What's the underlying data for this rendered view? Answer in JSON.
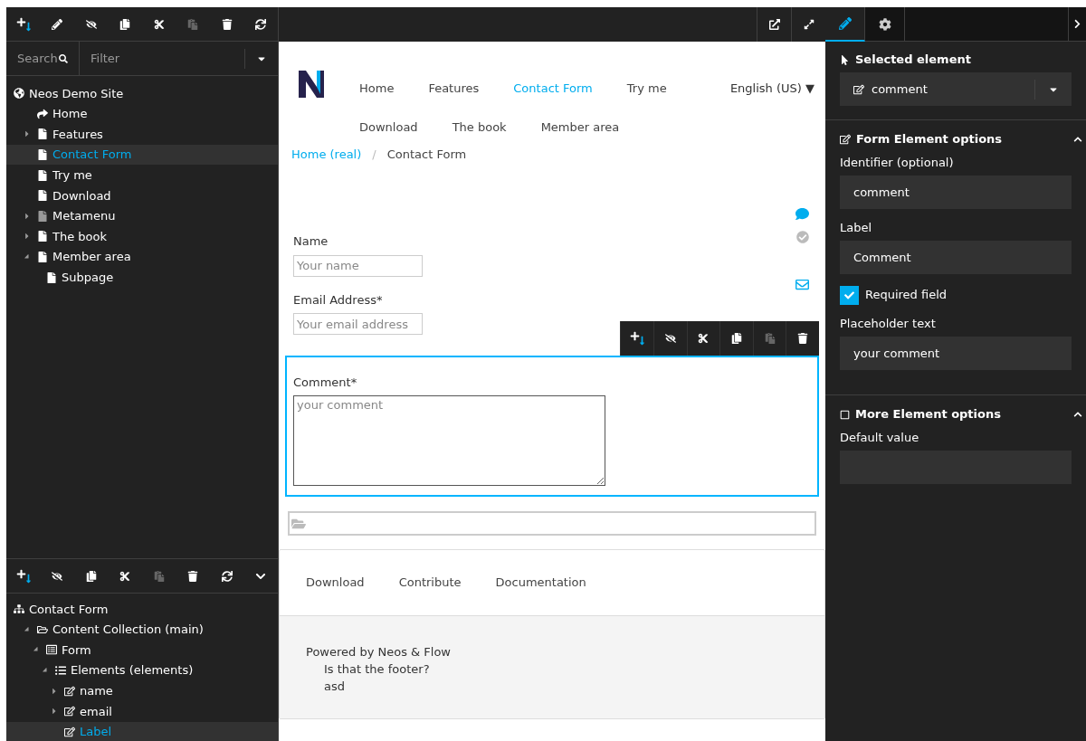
{
  "left_toolbar": [
    {
      "kind": "add",
      "disabled": false
    },
    {
      "kind": "edit",
      "disabled": false
    },
    {
      "kind": "hide",
      "disabled": false
    },
    {
      "kind": "copy",
      "disabled": false
    },
    {
      "kind": "cut",
      "disabled": false
    },
    {
      "kind": "paste",
      "disabled": true
    },
    {
      "kind": "delete",
      "disabled": false
    },
    {
      "kind": "refresh",
      "disabled": false
    }
  ],
  "search": {
    "placeholder": "Search"
  },
  "filter": {
    "placeholder": "Filter"
  },
  "page_tree": [
    {
      "kind": "globe",
      "label": "Neos Demo Site",
      "selected": false,
      "children": [
        {
          "kind": "shortcut",
          "label": "Home",
          "selected": false
        },
        {
          "kind": "page",
          "label": "Features",
          "selected": false,
          "expanded": false
        },
        {
          "kind": "page",
          "label": "Contact Form",
          "selected": true
        },
        {
          "kind": "page",
          "label": "Try me",
          "selected": false
        },
        {
          "kind": "page",
          "label": "Download",
          "selected": false
        },
        {
          "kind": "page-hidden",
          "label": "Metamenu",
          "selected": false,
          "expanded": false
        },
        {
          "kind": "page",
          "label": "The book",
          "selected": false,
          "expanded": false
        },
        {
          "kind": "page",
          "label": "Member area",
          "selected": false,
          "expanded": true,
          "children": [
            {
              "kind": "page",
              "label": "Subpage",
              "selected": false
            }
          ]
        }
      ]
    }
  ],
  "structure_toolbar": [
    {
      "kind": "add",
      "disabled": false
    },
    {
      "kind": "hide",
      "disabled": false
    },
    {
      "kind": "copy",
      "disabled": false
    },
    {
      "kind": "cut",
      "disabled": false
    },
    {
      "kind": "paste",
      "disabled": true
    },
    {
      "kind": "delete",
      "disabled": false
    },
    {
      "kind": "refresh",
      "disabled": false
    },
    {
      "kind": "collapse",
      "disabled": false
    }
  ],
  "structure_tree": [
    {
      "kind": "sitemap",
      "label": "Contact Form",
      "selected": false,
      "children": [
        {
          "kind": "folder",
          "label": "Content Collection (main)",
          "selected": false,
          "expanded": true,
          "children": [
            {
              "kind": "form",
              "label": "Form",
              "selected": false,
              "expanded": true,
              "children": [
                {
                  "kind": "list",
                  "label": "Elements (elements)",
                  "selected": false,
                  "expanded": true,
                  "children": [
                    {
                      "kind": "edit",
                      "label": "name",
                      "selected": false,
                      "expanded": false
                    },
                    {
                      "kind": "edit",
                      "label": "email",
                      "selected": false,
                      "expanded": false
                    },
                    {
                      "kind": "edit",
                      "label": "Label",
                      "selected": true
                    }
                  ]
                }
              ]
            }
          ]
        }
      ]
    }
  ],
  "top_bar": [
    {
      "kind": "preview"
    },
    {
      "kind": "fullscreen"
    }
  ],
  "site": {
    "nav_rows": [
      [
        {
          "label": "Home",
          "selected": false
        },
        {
          "label": "Features",
          "selected": false
        },
        {
          "label": "Contact Form",
          "selected": true
        },
        {
          "label": "Try me",
          "selected": false
        }
      ],
      [
        {
          "label": "Download",
          "selected": false
        },
        {
          "label": "The book",
          "selected": false
        },
        {
          "label": "Member area",
          "selected": false
        }
      ]
    ],
    "language": "English (US) ▼",
    "breadcrumb": [
      {
        "label": "Home (real)",
        "link": true
      },
      {
        "label": "Contact Form",
        "link": false
      }
    ],
    "breadcrumb_separator": "/",
    "form_fields": [
      {
        "kind": "input",
        "label": "Name",
        "placeholder": "Your name",
        "selected": false
      },
      {
        "kind": "input",
        "label": "Email Address*",
        "placeholder": "Your email address",
        "selected": false
      },
      {
        "kind": "textarea",
        "label": "Comment*",
        "placeholder": "your comment",
        "selected": true
      }
    ],
    "element_toolbar": [
      {
        "kind": "add",
        "disabled": false
      },
      {
        "kind": "hide",
        "disabled": false
      },
      {
        "kind": "cut",
        "disabled": false
      },
      {
        "kind": "copy",
        "disabled": false
      },
      {
        "kind": "paste",
        "disabled": true
      },
      {
        "kind": "delete",
        "disabled": false
      }
    ],
    "footer_links": [
      "Download",
      "Contribute",
      "Documentation"
    ],
    "footer_credit": "Powered by Neos & Flow",
    "footer_lines": [
      "Is that the footer?",
      "asd"
    ]
  },
  "inspector": {
    "tabs": [
      {
        "kind": "edit",
        "selected": true
      },
      {
        "kind": "settings",
        "selected": false
      }
    ],
    "selected_title": "Selected element",
    "selected_value": "comment",
    "sections": [
      {
        "title": "Form Element options",
        "kind": "edit",
        "expanded": true,
        "fields": [
          {
            "kind": "text",
            "label": "Identifier (optional)",
            "value": "comment"
          },
          {
            "kind": "text",
            "label": "Label",
            "value": "Comment"
          },
          {
            "kind": "checkbox",
            "label": "Required field",
            "checked": true
          },
          {
            "kind": "text",
            "label": "Placeholder text",
            "value": "your comment"
          }
        ]
      },
      {
        "title": "More Element options",
        "kind": "square",
        "expanded": true,
        "fields": [
          {
            "kind": "text",
            "label": "Default value"
          }
        ]
      }
    ]
  }
}
